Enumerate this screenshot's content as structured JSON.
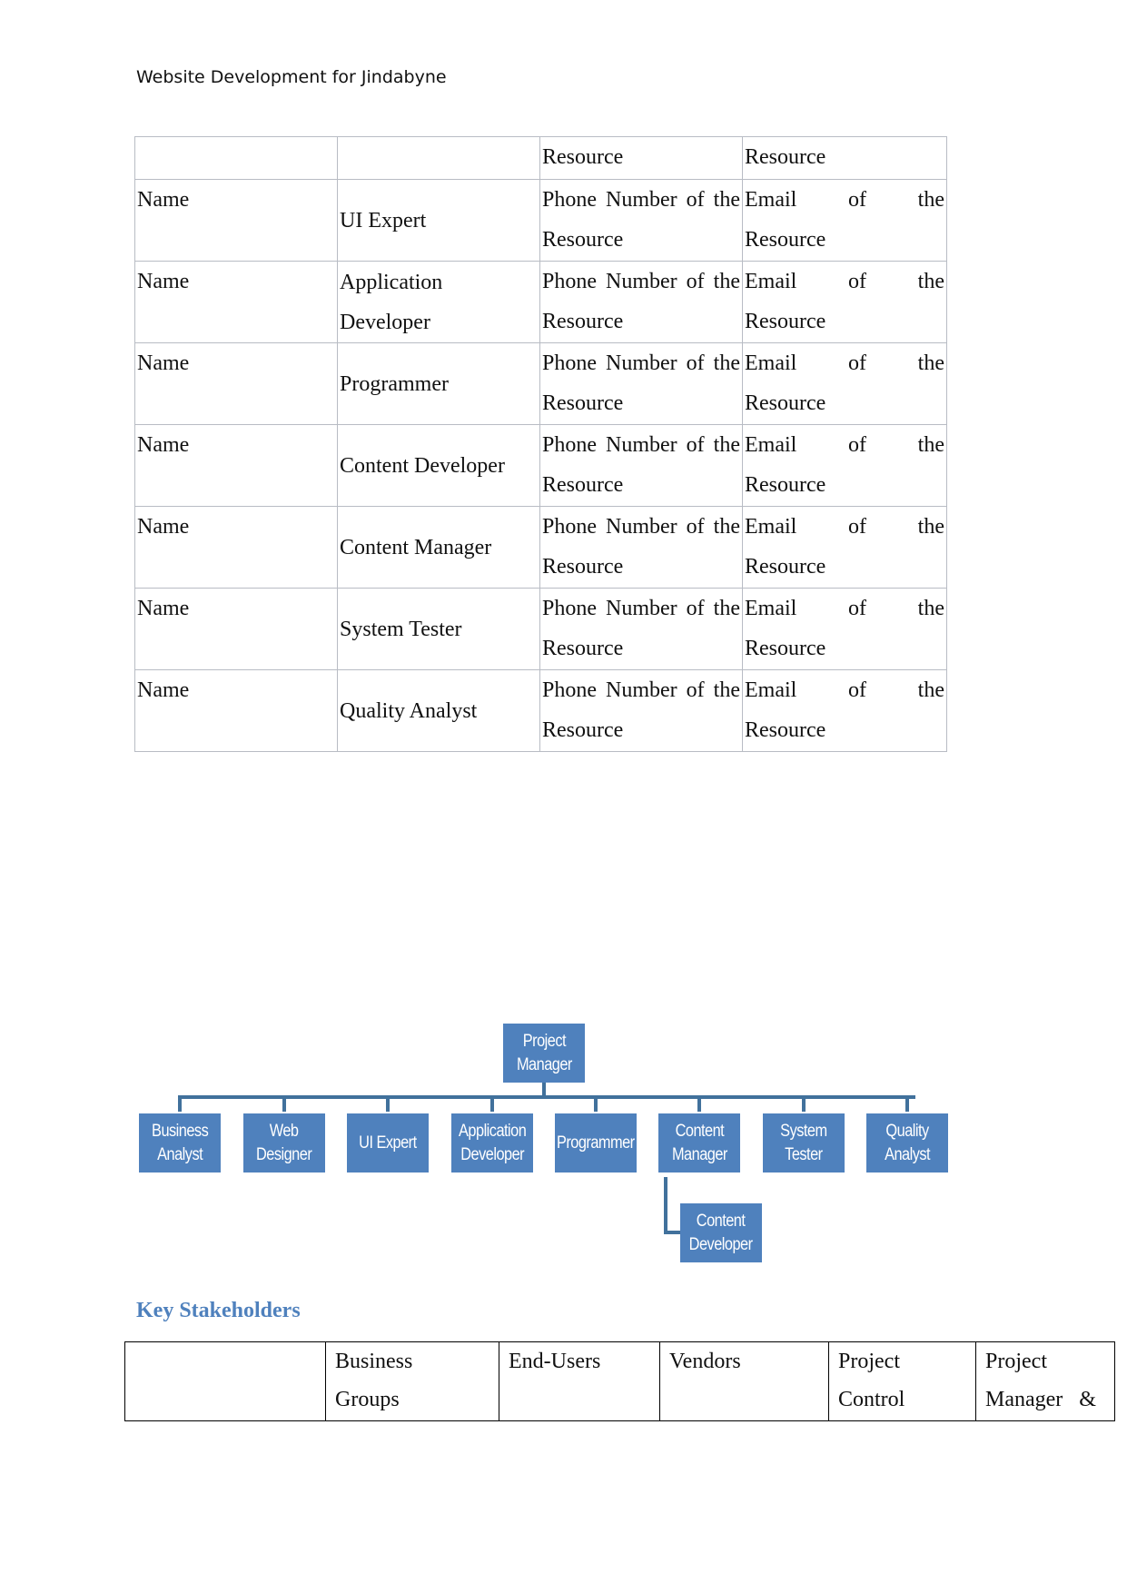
{
  "header": {
    "title": "Website Development for Jindabyne"
  },
  "resource_table": {
    "header_row": [
      "",
      "",
      "Resource",
      "Resource"
    ],
    "rows": [
      {
        "name": "Name",
        "role": "UI Expert",
        "phone_line1": "Phone Number of the",
        "phone_line2": "Resource",
        "email_line1": "Email of the",
        "email_line2": "Resource"
      },
      {
        "name": "Name",
        "role": "Application Developer",
        "phone_line1": "Phone Number of the",
        "phone_line2": "Resource",
        "email_line1": "Email of the",
        "email_line2": "Resource"
      },
      {
        "name": "Name",
        "role": "Programmer",
        "phone_line1": "Phone Number of the",
        "phone_line2": "Resource",
        "email_line1": "Email of the",
        "email_line2": "Resource"
      },
      {
        "name": "Name",
        "role": "Content Developer",
        "phone_line1": "Phone Number of the",
        "phone_line2": "Resource",
        "email_line1": "Email of the",
        "email_line2": "Resource"
      },
      {
        "name": "Name",
        "role": "Content Manager",
        "phone_line1": "Phone Number of the",
        "phone_line2": "Resource",
        "email_line1": "Email of the",
        "email_line2": "Resource"
      },
      {
        "name": "Name",
        "role": "System Tester",
        "phone_line1": "Phone Number of the",
        "phone_line2": "Resource",
        "email_line1": "Email of the",
        "email_line2": "Resource"
      },
      {
        "name": "Name",
        "role": "Quality Analyst",
        "phone_line1": "Phone Number of the",
        "phone_line2": "Resource",
        "email_line1": "Email of the",
        "email_line2": "Resource"
      }
    ]
  },
  "org_chart": {
    "root": "Project\nManager",
    "children": [
      "Business\nAnalyst",
      "Web\nDesigner",
      "UI Expert",
      "Application\nDeveloper",
      "Programmer",
      "Content\nManager",
      "System\nTester",
      "Quality\nAnalyst"
    ],
    "sub_child_of_content_manager": "Content\nDeveloper",
    "box_color": "#4f81bd",
    "connector_color": "#41719c"
  },
  "key_stakeholders": {
    "heading": "Key Stakeholders",
    "columns": [
      {
        "line1": "",
        "line2": ""
      },
      {
        "line1": "Business",
        "line2": "Groups"
      },
      {
        "line1": "End-Users",
        "line2": ""
      },
      {
        "line1": "Vendors",
        "line2": ""
      },
      {
        "line1": "Project",
        "line2": "Control"
      },
      {
        "line1": "Project",
        "line2": "Manager   &"
      }
    ]
  }
}
